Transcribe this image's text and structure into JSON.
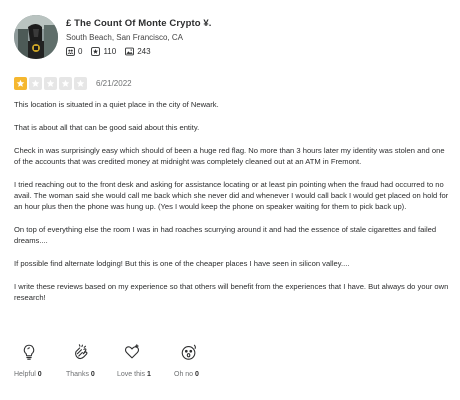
{
  "user": {
    "name": "£ The Count Of Monte Crypto ¥.",
    "location": "South Beach, San Francisco, CA",
    "stats": {
      "friends": "0",
      "reviews": "110",
      "photos": "243"
    }
  },
  "review": {
    "rating": 1,
    "max_rating": 5,
    "date": "6/21/2022",
    "paragraphs": [
      "This location is situated in a quiet place in the city of Newark.",
      "That is about all that can be good said about this entity.",
      "Check in was surprisingly easy which should of been a huge red flag. No more than 3 hours later my identity was stolen and one of the accounts that was credited money at midnight was completely cleaned out at an ATM in Fremont.",
      "I tried reaching out to the front desk and asking for assistance locating or at least pin pointing when the fraud had occurred to no avail. The woman said she would call me back which she never did and whenever I would call back I would get placed on hold for an hour plus then the phone was hung up. (Yes I would keep the phone on speaker waiting for them to pick back up).",
      "On top of everything else the room I was in had roaches scurrying around it and had the essence of stale cigarettes and failed dreams....",
      "If possible find alternate lodging! But this is one of the cheaper places I have seen in silicon valley....",
      "I write these reviews based on my experience so that others will benefit from the experiences that I have. But always do your own research!"
    ]
  },
  "reactions": [
    {
      "label": "Helpful",
      "count": "0",
      "icon": "lightbulb-icon"
    },
    {
      "label": "Thanks",
      "count": "0",
      "icon": "clapping-hands-icon"
    },
    {
      "label": "Love this",
      "count": "1",
      "icon": "heart-icon"
    },
    {
      "label": "Oh no",
      "count": "0",
      "icon": "shocked-face-icon"
    }
  ],
  "colors": {
    "star_filled": "#f5b72f",
    "star_empty": "#e6e6e6",
    "text": "#2d2e2f",
    "muted": "#6e7072"
  }
}
